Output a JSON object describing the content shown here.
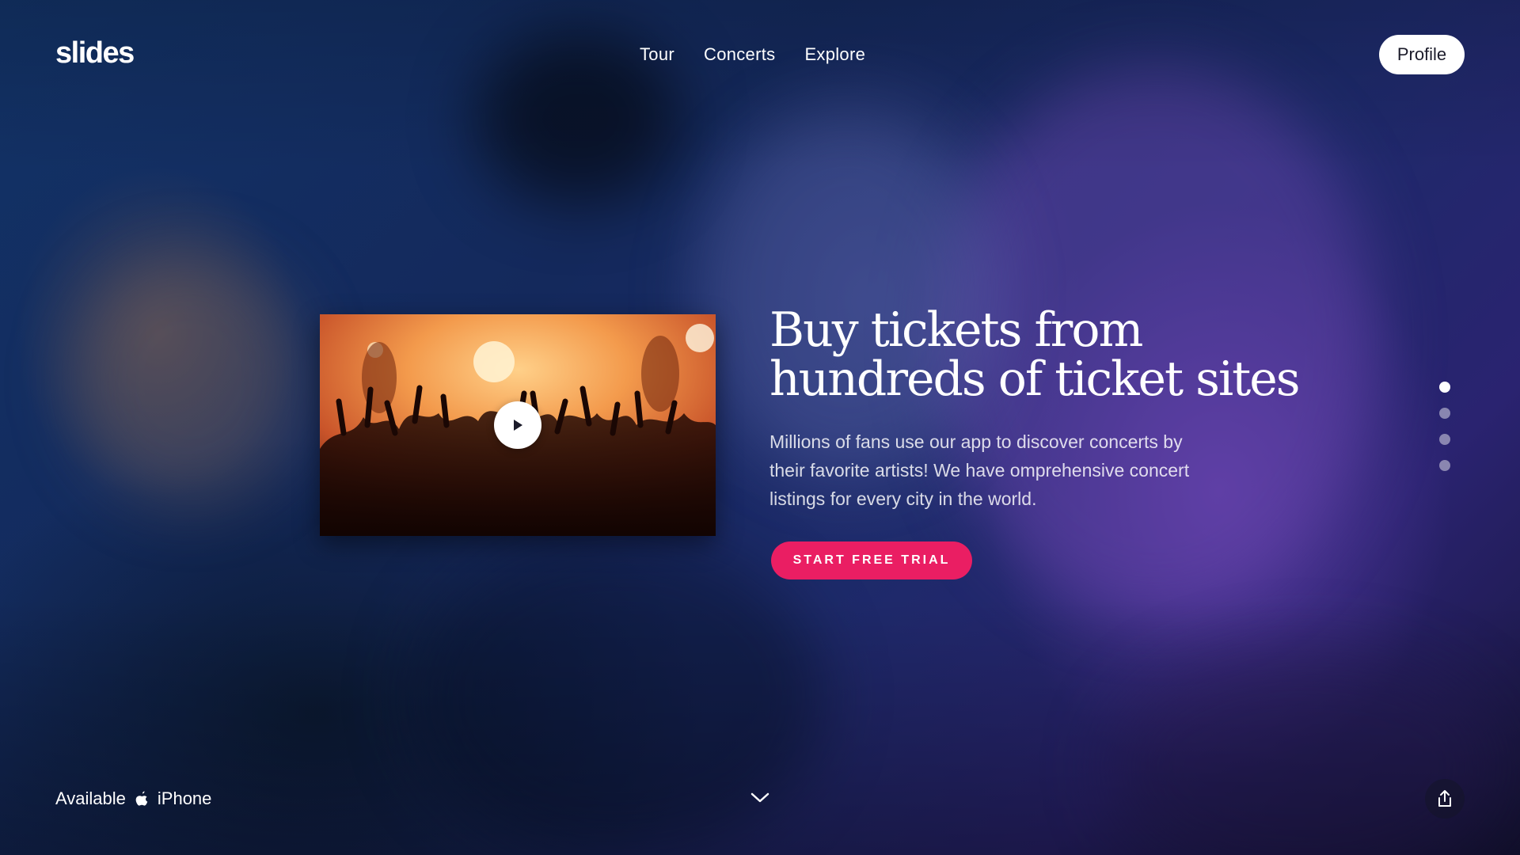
{
  "brand": {
    "logo_text": "slides"
  },
  "nav": {
    "items": [
      {
        "label": "Tour"
      },
      {
        "label": "Concerts"
      },
      {
        "label": "Explore"
      }
    ],
    "profile_label": "Profile"
  },
  "hero": {
    "headline_line1": "Buy tickets from",
    "headline_line2": "hundreds of ticket sites",
    "subtext": "Millions of fans use our app to discover concerts by their favorite artists! We have omprehensive concert listings for every city in the world.",
    "cta_label": "START FREE TRIAL",
    "video": {
      "icon": "play-icon"
    }
  },
  "slider": {
    "count": 4,
    "active_index": 0
  },
  "footer": {
    "available_label": "Available",
    "platform_icon": "apple-icon",
    "platform_label": "iPhone",
    "scroll_icon": "chevron-down-icon",
    "share_icon": "share-icon"
  },
  "colors": {
    "accent": "#ea1e63",
    "background": "#14295c",
    "text": "#ffffff"
  }
}
